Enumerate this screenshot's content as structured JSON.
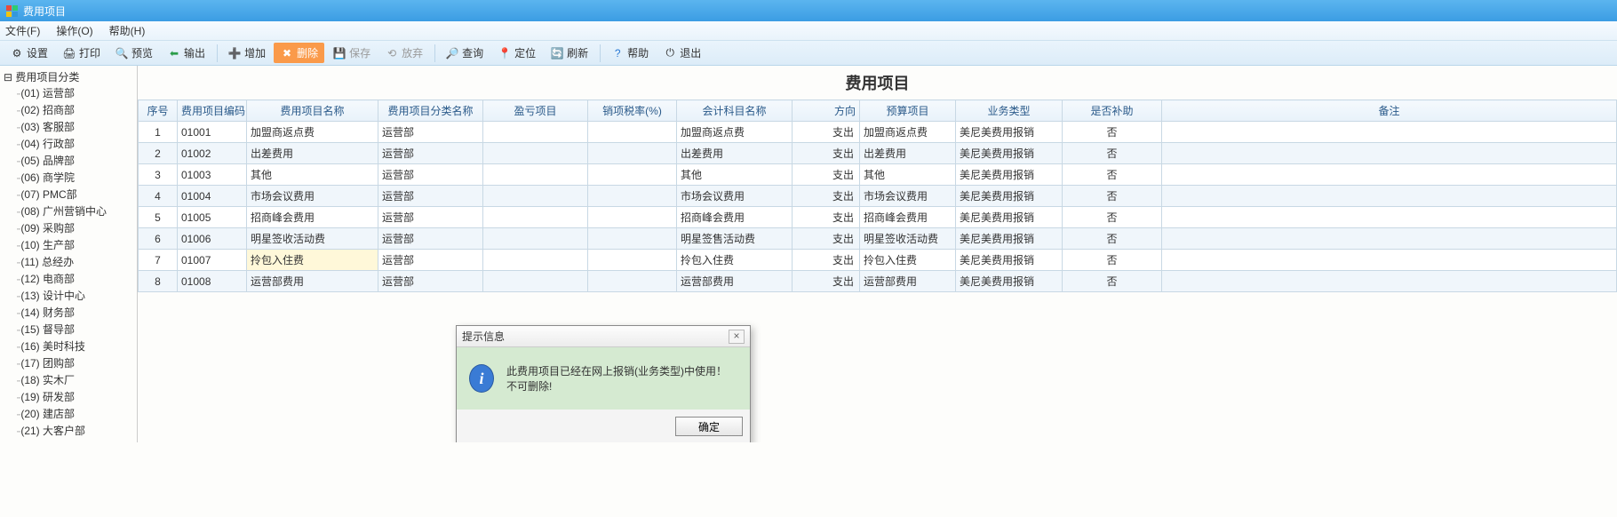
{
  "window": {
    "title": "费用项目"
  },
  "menu": {
    "file": "文件(F)",
    "operate": "操作(O)",
    "help": "帮助(H)"
  },
  "toolbar": {
    "setting": "设置",
    "print": "打印",
    "preview": "预览",
    "export": "输出",
    "add": "增加",
    "delete": "删除",
    "save": "保存",
    "discard": "放弃",
    "query": "查询",
    "locate": "定位",
    "refresh": "刷新",
    "help": "帮助",
    "exit": "退出"
  },
  "tree": {
    "root": "费用项目分类",
    "items": [
      "(01) 运营部",
      "(02) 招商部",
      "(03) 客服部",
      "(04) 行政部",
      "(05) 品牌部",
      "(06) 商学院",
      "(07) PMC部",
      "(08) 广州营销中心",
      "(09) 采购部",
      "(10) 生产部",
      "(11) 总经办",
      "(12) 电商部",
      "(13) 设计中心",
      "(14) 财务部",
      "(15) 督导部",
      "(16) 美时科技",
      "(17) 团购部",
      "(18) 实木厂",
      "(19) 研发部",
      "(20) 建店部",
      "(21) 大客户部"
    ]
  },
  "page": {
    "title": "费用项目"
  },
  "columns": {
    "seq": "序号",
    "code": "费用项目编码",
    "name": "费用项目名称",
    "cat": "费用项目分类名称",
    "pl": "盈亏项目",
    "tax": "销项税率(%)",
    "acct": "会计科目名称",
    "dir": "方向",
    "budget": "预算项目",
    "biz": "业务类型",
    "aux": "是否补助",
    "note": "备注"
  },
  "rows": [
    {
      "seq": "1",
      "code": "01001",
      "name": "加盟商返点费",
      "cat": "运营部",
      "pl": "",
      "tax": "",
      "acct": "加盟商返点费",
      "dir": "支出",
      "budget": "加盟商返点费",
      "biz": "美尼美费用报销",
      "aux": "否",
      "note": ""
    },
    {
      "seq": "2",
      "code": "01002",
      "name": "出差费用",
      "cat": "运营部",
      "pl": "",
      "tax": "",
      "acct": "出差费用",
      "dir": "支出",
      "budget": "出差费用",
      "biz": "美尼美费用报销",
      "aux": "否",
      "note": ""
    },
    {
      "seq": "3",
      "code": "01003",
      "name": "其他",
      "cat": "运营部",
      "pl": "",
      "tax": "",
      "acct": "其他",
      "dir": "支出",
      "budget": "其他",
      "biz": "美尼美费用报销",
      "aux": "否",
      "note": ""
    },
    {
      "seq": "4",
      "code": "01004",
      "name": "市场会议费用",
      "cat": "运营部",
      "pl": "",
      "tax": "",
      "acct": "市场会议费用",
      "dir": "支出",
      "budget": "市场会议费用",
      "biz": "美尼美费用报销",
      "aux": "否",
      "note": ""
    },
    {
      "seq": "5",
      "code": "01005",
      "name": "招商峰会费用",
      "cat": "运营部",
      "pl": "",
      "tax": "",
      "acct": "招商峰会费用",
      "dir": "支出",
      "budget": "招商峰会费用",
      "biz": "美尼美费用报销",
      "aux": "否",
      "note": ""
    },
    {
      "seq": "6",
      "code": "01006",
      "name": "明星签收活动费",
      "cat": "运营部",
      "pl": "",
      "tax": "",
      "acct": "明星签售活动费",
      "dir": "支出",
      "budget": "明星签收活动费",
      "biz": "美尼美费用报销",
      "aux": "否",
      "note": ""
    },
    {
      "seq": "7",
      "code": "01007",
      "name": "拎包入住费",
      "cat": "运营部",
      "pl": "",
      "tax": "",
      "acct": "拎包入住费",
      "dir": "支出",
      "budget": "拎包入住费",
      "biz": "美尼美费用报销",
      "aux": "否",
      "note": "",
      "highlight": true
    },
    {
      "seq": "8",
      "code": "01008",
      "name": "运营部费用",
      "cat": "运营部",
      "pl": "",
      "tax": "",
      "acct": "运营部费用",
      "dir": "支出",
      "budget": "运营部费用",
      "biz": "美尼美费用报销",
      "aux": "否",
      "note": ""
    }
  ],
  "dialog": {
    "title": "提示信息",
    "message": "此费用项目已经在网上报销(业务类型)中使用！不可删除!",
    "ok": "确定"
  }
}
